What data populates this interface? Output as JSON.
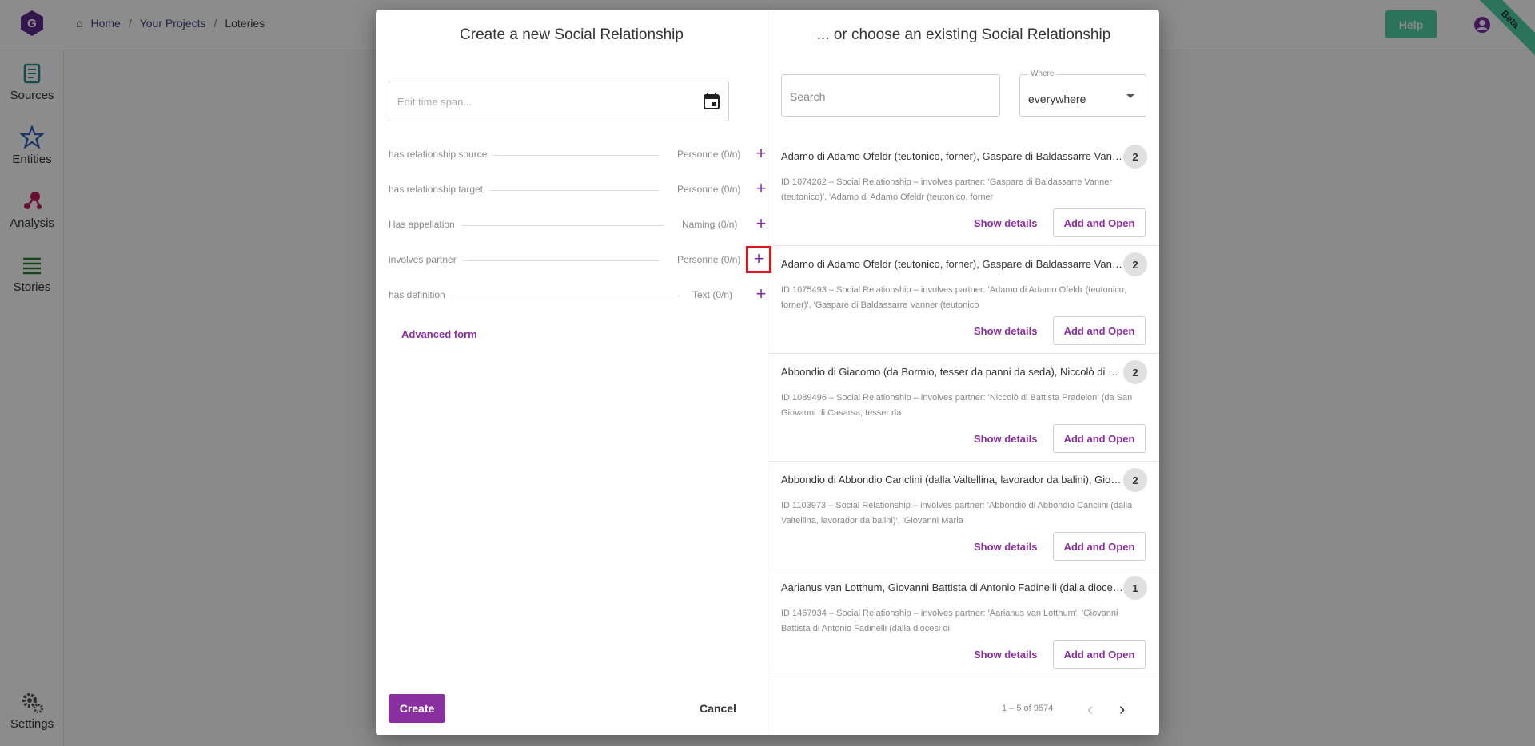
{
  "header": {
    "breadcrumb": [
      {
        "label": "Home"
      },
      {
        "label": "Your Projects"
      },
      {
        "label": "Loteries"
      }
    ],
    "help_label": "Help",
    "beta_label": "Beta"
  },
  "sidenav": {
    "items": [
      {
        "label": "Sources",
        "icon": "scroll-icon"
      },
      {
        "label": "Entities",
        "icon": "star-icon"
      },
      {
        "label": "Analysis",
        "icon": "network-icon"
      },
      {
        "label": "Stories",
        "icon": "lines-icon"
      },
      {
        "label": "Settings",
        "icon": "gear-icon"
      }
    ]
  },
  "dialog": {
    "left_title": "Create a new Social Relationship",
    "right_title": "... or choose an existing Social Relationship",
    "timespan_placeholder": "Edit time span...",
    "fields": [
      {
        "label": "has relationship source",
        "type": "Personne",
        "count": "(0/n)"
      },
      {
        "label": "has relationship target",
        "type": "Personne",
        "count": "(0/n)"
      },
      {
        "label": "Has appellation",
        "type": "Naming",
        "count": "(0/n)"
      },
      {
        "label": "involves partner",
        "type": "Personne",
        "count": "(0/n)"
      },
      {
        "label": "has definition",
        "type": "Text",
        "count": "(0/n)"
      }
    ],
    "advanced_form": "Advanced form",
    "create_label": "Create",
    "cancel_label": "Cancel",
    "search_placeholder": "Search",
    "where_label": "Where",
    "where_value": "everywhere",
    "results": [
      {
        "title": "Adamo di Adamo Ofeldr (teutonico, forner), Gaspare di Baldassarre Vanner (teutonico)",
        "count": "2",
        "desc": "ID 1074262 – Social Relationship – involves partner: 'Gaspare di Baldassarre Vanner (teutonico)', 'Adamo di Adamo Ofeldr (teutonico, forner"
      },
      {
        "title": "Adamo di Adamo Ofeldr (teutonico, forner), Gaspare di Baldassarre Vanner (teutonico)",
        "count": "2",
        "desc": "ID 1075493 – Social Relationship – involves partner: 'Adamo di Adamo Ofeldr (teutonico, forner)', 'Gaspare di Baldassarre Vanner (teutonico"
      },
      {
        "title": "Abbondio di Giacomo (da Bormio, tesser da panni da seda), Niccolò di Battista Pradeloni",
        "count": "2",
        "desc": "ID 1089496 – Social Relationship – involves partner: 'Niccolò di Battista Pradeloni (da San Giovanni di Casarsa, tesser da"
      },
      {
        "title": "Abbondio di Abbondio Canclini (dalla Valtellina, lavorador da balini), Giovanni Maria",
        "count": "2",
        "desc": "ID 1103973 – Social Relationship – involves partner: 'Abbondio di Abbondio Canclini (dalla Valtellina, lavorador da balini)', 'Giovanni Maria"
      },
      {
        "title": "Aarianus van Lotthum, Giovanni Battista di Antonio Fadinelli (dalla diocesi di",
        "count": "1",
        "desc": "ID 1467934 – Social Relationship – involves partner: 'Aarianus van Lotthum', 'Giovanni Battista di Antonio Fadinelli (dalla diocesi di"
      }
    ],
    "show_details_label": "Show details",
    "add_open_label": "Add and Open",
    "pagination": "1 – 5 of 9574"
  },
  "colors": {
    "accent": "#8a2fa0",
    "help": "#4fd1a5",
    "highlight": "#e0141e"
  }
}
